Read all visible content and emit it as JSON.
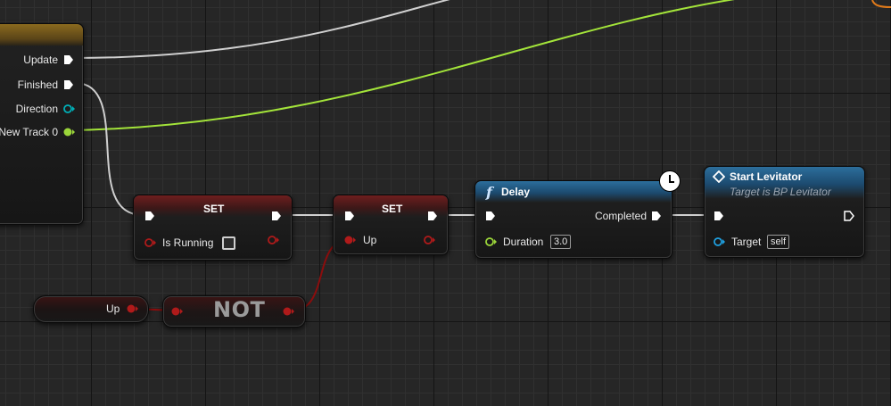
{
  "timeline_node": {
    "outputs": {
      "update": "Update",
      "finished": "Finished",
      "direction": "Direction",
      "track": "New Track 0"
    }
  },
  "set_node_1": {
    "title": "SET",
    "input_label": "Is Running"
  },
  "set_node_2": {
    "title": "SET",
    "input_label": "Up"
  },
  "delay_node": {
    "title": "Delay",
    "func_glyph": "f",
    "output_label": "Completed",
    "input_label": "Duration",
    "input_value": "3.0"
  },
  "levitator_node": {
    "title": "Start Levitator",
    "subtitle": "Target is BP Levitator",
    "input_label": "Target",
    "input_value": "self"
  },
  "getter_node": {
    "label": "Up"
  },
  "not_node": {
    "label": "NOT"
  },
  "colors": {
    "exec_wire": "#d9d9d9",
    "float_wire": "#a3e43a",
    "bool_wire": "#8c0d0d",
    "bool_pin": "#b01a1a",
    "object_pin": "#1fa0e0",
    "vector_pin": "#00b0b8",
    "float_pin": "#9bd63a"
  }
}
